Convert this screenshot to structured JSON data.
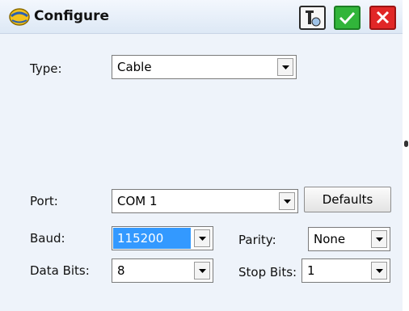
{
  "window": {
    "title": "Configure"
  },
  "toolbar": {
    "instrument_icon": "instrument-icon",
    "ok_icon": "checkmark-icon",
    "cancel_icon": "close-icon",
    "colors": {
      "ok": "#31b53a",
      "cancel": "#e12727"
    }
  },
  "form": {
    "type": {
      "label": "Type:",
      "value": "Cable"
    },
    "port": {
      "label": "Port:",
      "value": "COM 1"
    },
    "defaults_button": "Defaults",
    "baud": {
      "label": "Baud:",
      "value": "115200"
    },
    "parity": {
      "label": "Parity:",
      "value": "None"
    },
    "data_bits": {
      "label": "Data Bits:",
      "value": "8"
    },
    "stop_bits": {
      "label": "Stop Bits:",
      "value": "1"
    }
  }
}
